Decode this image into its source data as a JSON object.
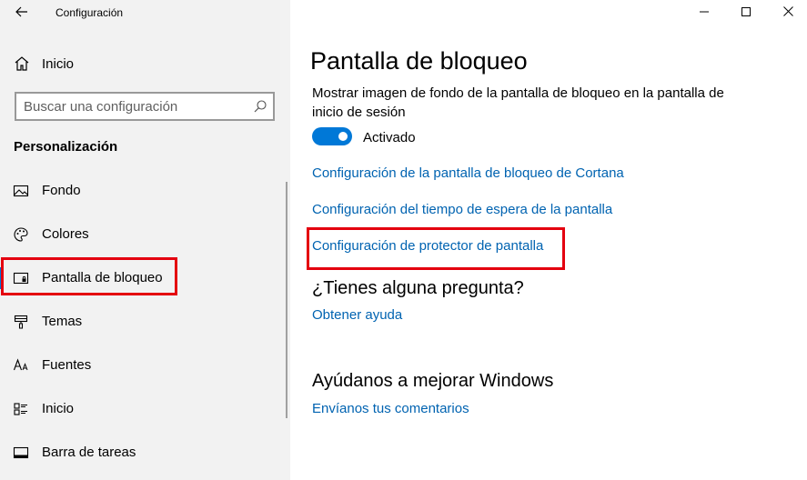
{
  "window": {
    "title": "Configuración"
  },
  "sidebar": {
    "home_label": "Inicio",
    "search_placeholder": "Buscar una configuración",
    "section_title": "Personalización",
    "items": [
      {
        "label": "Fondo",
        "icon": "image-icon"
      },
      {
        "label": "Colores",
        "icon": "palette-icon"
      },
      {
        "label": "Pantalla de bloqueo",
        "icon": "lock-screen-icon",
        "selected": true
      },
      {
        "label": "Temas",
        "icon": "brush-icon"
      },
      {
        "label": "Fuentes",
        "icon": "font-icon"
      },
      {
        "label": "Inicio",
        "icon": "start-icon"
      },
      {
        "label": "Barra de tareas",
        "icon": "taskbar-icon"
      }
    ]
  },
  "main": {
    "title": "Pantalla de bloqueo",
    "description": "Mostrar imagen de fondo de la pantalla de bloqueo en la pantalla de inicio de sesión",
    "toggle_state": "Activado",
    "links": {
      "cortana": "Configuración de la pantalla de bloqueo de Cortana",
      "timeout": "Configuración del tiempo de espera de la pantalla",
      "screensaver": "Configuración de protector de pantalla"
    },
    "question_heading": "¿Tienes alguna pregunta?",
    "help_link": "Obtener ayuda",
    "improve_heading": "Ayúdanos a mejorar Windows",
    "feedback_link": "Envíanos tus comentarios"
  },
  "colors": {
    "accent": "#0078d7",
    "link": "#0063b1",
    "highlight": "#e4000f",
    "sidebar_bg": "#f2f2f2"
  }
}
